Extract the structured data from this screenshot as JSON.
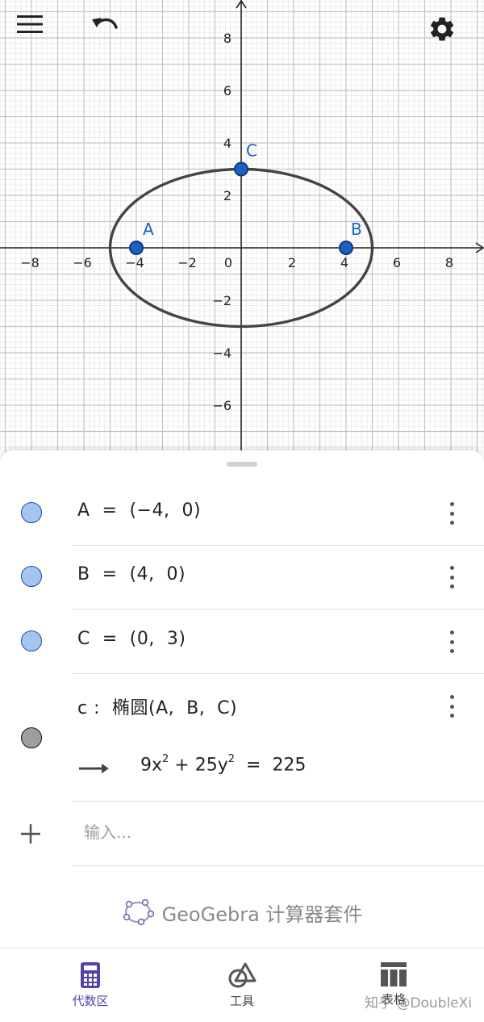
{
  "graphics": {
    "x_tick_labels": [
      "−8",
      "−6",
      "−4",
      "−2",
      "0",
      "2",
      "4",
      "6",
      "8"
    ],
    "y_tick_labels_pos": [
      "2",
      "4",
      "6",
      "8"
    ],
    "y_tick_labels_neg": [
      "−2",
      "−4",
      "−6"
    ],
    "points": [
      {
        "name": "A",
        "x": -4,
        "y": 0
      },
      {
        "name": "B",
        "x": 4,
        "y": 0
      },
      {
        "name": "C",
        "x": 0,
        "y": 3
      }
    ],
    "ellipse": {
      "cx": 0,
      "cy": 0,
      "a": 5,
      "b": 3
    },
    "colors": {
      "point_fill": "#1e5fc2",
      "point_stroke": "#0d3a80",
      "ellipse": "#444444",
      "axis": "#222222",
      "grid_major": "#c4c4c4",
      "grid_minor": "#ececec",
      "label": "#1565c0"
    }
  },
  "toolbar": {
    "menu_icon": "hamburger-menu-icon",
    "undo_icon": "undo-icon",
    "settings_icon": "gear-icon"
  },
  "algebra": {
    "rows": [
      {
        "expr": "A  =  (−4,  0)"
      },
      {
        "expr": "B  =  (4,  0)"
      },
      {
        "expr": "C  =  (0,  3)"
      }
    ],
    "conic": {
      "definition": "c :  椭圆(A,  B,  C)",
      "result_a": "9x",
      "result_b": " + 25y",
      "result_c": "  =  225",
      "exp": "2"
    },
    "input_placeholder": "输入..."
  },
  "brand": {
    "text": "GeoGebra 计算器套件"
  },
  "nav": {
    "algebra_label": "代数区",
    "tools_label": "工具",
    "table_label": "表格"
  },
  "watermark": "知乎 @DoubleXi"
}
